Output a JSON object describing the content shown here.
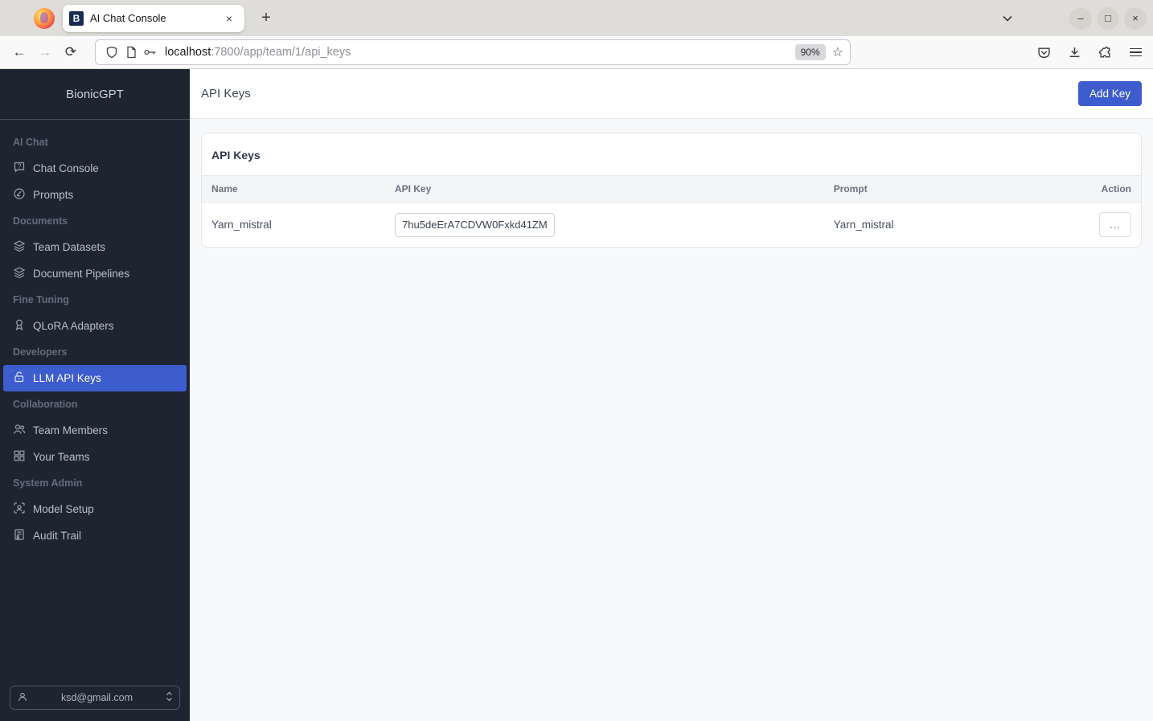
{
  "browser": {
    "tab": {
      "title": "AI Chat Console",
      "favicon_letter": "B",
      "close_label": "×"
    },
    "new_tab_label": "+",
    "tabs_chevron": "⌄",
    "window": {
      "minimize": "–",
      "maximize": "□",
      "close": "×"
    },
    "nav": {
      "back": "←",
      "forward": "→",
      "reload": "⟳"
    },
    "url": {
      "host": "localhost",
      "path": ":7800/app/team/1/api_keys"
    },
    "zoom_badge": "90%",
    "star": "☆"
  },
  "sidebar": {
    "brand": "BionicGPT",
    "sections": [
      {
        "label": "AI Chat",
        "items": [
          {
            "label": "Chat Console",
            "icon": "chat-question-icon"
          },
          {
            "label": "Prompts",
            "icon": "prompt-icon"
          }
        ]
      },
      {
        "label": "Documents",
        "items": [
          {
            "label": "Team Datasets",
            "icon": "layers-icon"
          },
          {
            "label": "Document Pipelines",
            "icon": "layers-icon"
          }
        ]
      },
      {
        "label": "Fine Tuning",
        "items": [
          {
            "label": "QLoRA Adapters",
            "icon": "award-icon"
          }
        ]
      },
      {
        "label": "Developers",
        "items": [
          {
            "label": "LLM API Keys",
            "icon": "unlock-icon",
            "active": true
          }
        ]
      },
      {
        "label": "Collaboration",
        "items": [
          {
            "label": "Team Members",
            "icon": "users-icon"
          },
          {
            "label": "Your Teams",
            "icon": "grid-icon"
          }
        ]
      },
      {
        "label": "System Admin",
        "items": [
          {
            "label": "Model Setup",
            "icon": "user-scan-icon"
          },
          {
            "label": "Audit Trail",
            "icon": "audit-document-icon"
          }
        ]
      }
    ],
    "user_select": {
      "value": "ksd@gmail.com"
    }
  },
  "header": {
    "title": "API Keys",
    "add_button": "Add Key"
  },
  "card": {
    "title": "API Keys",
    "table": {
      "columns": {
        "name": "Name",
        "api_key": "API Key",
        "prompt": "Prompt",
        "action": "Action"
      },
      "rows": [
        {
          "name": "Yarn_mistral",
          "api_key": "7hu5deErA7CDVW0Fxkd41ZM",
          "prompt": "Yarn_mistral",
          "action": "..."
        }
      ]
    }
  },
  "colors": {
    "accent_blue": "#3d5cce",
    "sidebar_bg": "#1d2531",
    "page_bg": "#f8f9fa",
    "favicon_bg": "#1a2b53"
  }
}
